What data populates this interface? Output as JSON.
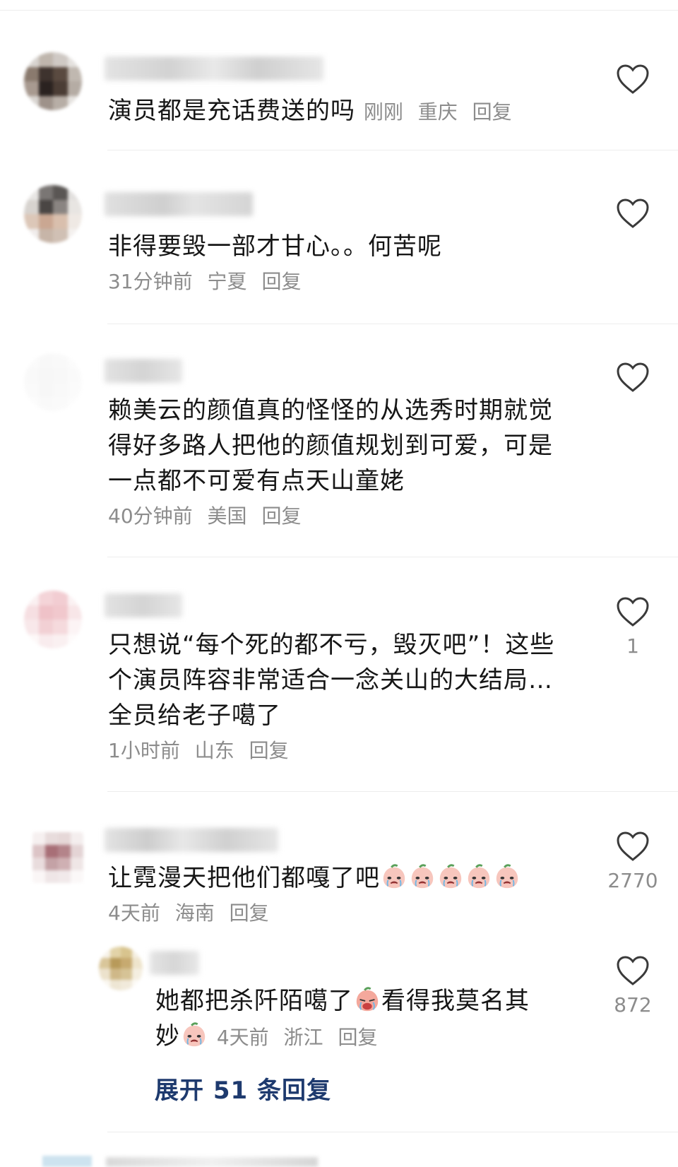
{
  "comments": [
    {
      "text": "演员都是充话费送的吗",
      "time": "刚刚",
      "location": "重庆",
      "reply": "回复",
      "likes": ""
    },
    {
      "text": "非得要毁一部才甘心。。何苦呢",
      "time": "31分钟前",
      "location": "宁夏",
      "reply": "回复",
      "likes": ""
    },
    {
      "text": "赖美云的颜值真的怪怪的从选秀时期就觉得好多路人把他的颜值规划到可爱，可是一点都不可爱有点天山童姥",
      "time": "40分钟前",
      "location": "美国",
      "reply": "回复",
      "likes": ""
    },
    {
      "text": "只想说“每个死的都不亏，毁灭吧”！这些个演员阵容非常适合一念关山的大结局…全员给老子噶了",
      "time": "1小时前",
      "location": "山东",
      "reply": "回复",
      "likes": "1"
    },
    {
      "text": "让霓漫天把他们都嘎了吧",
      "time": "4天前",
      "location": "海南",
      "reply": "回复",
      "likes": "2770"
    }
  ],
  "reply": {
    "text_a": "她都把杀阡陌噶了",
    "text_b": "看得我莫名其",
    "text_c": "妙",
    "time": "4天前",
    "location": "浙江",
    "reply": "回复",
    "likes": "872"
  },
  "expand_label": "展开 51 条回复",
  "icons": {
    "like": "heart-outline-icon",
    "emoji": "crying-peach-emoji"
  },
  "colors": {
    "text": "#161616",
    "meta": "#8c8c8c",
    "expand": "#1e3a6e",
    "divider": "#ededed"
  }
}
